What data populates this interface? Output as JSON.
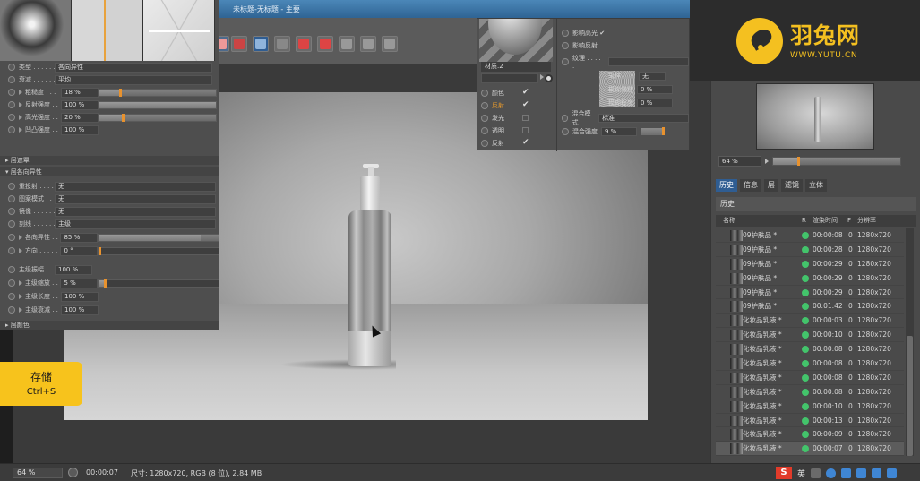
{
  "app": {
    "window_title": "未标题-无标题 - 主要"
  },
  "left_panel": {
    "rows_top": [
      {
        "label": "类型 . . . . . .",
        "value": "各向异性"
      },
      {
        "label": "衰减 . . . . . .",
        "value": "平均"
      },
      {
        "label": "粗糙度 . . .",
        "value": "18 %",
        "fill": 0.18
      },
      {
        "label": "反射强度 . .",
        "value": "100 %",
        "fill": 1.0
      },
      {
        "label": "高光强度 . .",
        "value": "20 %",
        "fill": 0.2
      },
      {
        "label": "凹凸强度 . .",
        "value": "100 %",
        "fill": 1.0
      }
    ],
    "section_layer_mask": "▸ 层遮罩",
    "section_anisotropy": "▾ 层各向异性",
    "rows_aniso": [
      {
        "label": "重投射 . . . .",
        "value": "无"
      },
      {
        "label": "图案模式 . .",
        "value": "无"
      },
      {
        "label": "镜像 . . . . . .",
        "value": "无"
      },
      {
        "label": "刻线 . . . . . .",
        "value": "主级"
      },
      {
        "label": "各向异性 . .",
        "value": "85 %"
      },
      {
        "label": "方向 . . . . . .",
        "value": "0 °"
      }
    ],
    "rows_primary": [
      {
        "label": "主级振幅 . .",
        "value": "100 %"
      },
      {
        "label": "主级缩放 . .",
        "value": "5 %",
        "fill": 0.05
      },
      {
        "label": "主级长度 . .",
        "value": "100 %"
      },
      {
        "label": "主级衰减 . .",
        "value": "100 %"
      }
    ],
    "section_layer_color": "▸ 层颜色"
  },
  "material_editor": {
    "material_name": "材质.2",
    "channels": [
      {
        "label": "颜色",
        "checked": "✔",
        "highlight": false
      },
      {
        "label": "反射",
        "checked": "✔",
        "highlight": true
      },
      {
        "label": "发光",
        "checked": "",
        "highlight": false
      },
      {
        "label": "透明",
        "checked": "",
        "highlight": false
      },
      {
        "label": "反射",
        "checked": "✔",
        "highlight": false
      }
    ],
    "opt_highlight": "影响高光 ✔",
    "opt_reflect": "影响反射",
    "texture_label": "纹理 . . . . .",
    "sampling_label": "采样",
    "sampling_value": "无",
    "blur_offset_label": "模糊偏移",
    "blur_offset_value": "0 %",
    "blur_scale_label": "模糊程度",
    "blur_scale_value": "0 %",
    "blend_mode_label": "混合模式",
    "blend_mode_value": "标准",
    "blend_strength_label": "混合强度",
    "blend_strength_value": "9 %"
  },
  "logo": {
    "name": "羽兔网",
    "url": "WWW.YUTU.CN"
  },
  "right_panel": {
    "zoom": "64 %",
    "zoom_fill": 0.2,
    "tabs": [
      "历史",
      "信息",
      "层",
      "滤镜",
      "立体"
    ],
    "history_title": "历史",
    "columns": {
      "name": "名称",
      "r": "R",
      "time": "渲染时间",
      "f": "F",
      "res": "分辨率"
    },
    "rows": [
      {
        "name": "09护肤品 *",
        "time": "00:00:08",
        "f": "0",
        "res": "1280x720"
      },
      {
        "name": "09护肤品 *",
        "time": "00:00:28",
        "f": "0",
        "res": "1280x720"
      },
      {
        "name": "09护肤品 *",
        "time": "00:00:29",
        "f": "0",
        "res": "1280x720"
      },
      {
        "name": "09护肤品 *",
        "time": "00:00:29",
        "f": "0",
        "res": "1280x720"
      },
      {
        "name": "09护肤品 *",
        "time": "00:00:29",
        "f": "0",
        "res": "1280x720"
      },
      {
        "name": "09护肤品 *",
        "time": "00:01:42",
        "f": "0",
        "res": "1280x720"
      },
      {
        "name": "化妆品乳液 *",
        "time": "00:00:03",
        "f": "0",
        "res": "1280x720"
      },
      {
        "name": "化妆品乳液 *",
        "time": "00:00:10",
        "f": "0",
        "res": "1280x720"
      },
      {
        "name": "化妆品乳液 *",
        "time": "00:00:08",
        "f": "0",
        "res": "1280x720"
      },
      {
        "name": "化妆品乳液 *",
        "time": "00:00:08",
        "f": "0",
        "res": "1280x720"
      },
      {
        "name": "化妆品乳液 *",
        "time": "00:00:08",
        "f": "0",
        "res": "1280x720"
      },
      {
        "name": "化妆品乳液 *",
        "time": "00:00:08",
        "f": "0",
        "res": "1280x720"
      },
      {
        "name": "化妆品乳液 *",
        "time": "00:00:10",
        "f": "0",
        "res": "1280x720"
      },
      {
        "name": "化妆品乳液 *",
        "time": "00:00:13",
        "f": "0",
        "res": "1280x720"
      },
      {
        "name": "化妆品乳液 *",
        "time": "00:00:09",
        "f": "0",
        "res": "1280x720"
      },
      {
        "name": "化妆品乳液 *",
        "time": "00:00:07",
        "f": "0",
        "res": "1280x720"
      }
    ]
  },
  "save_hint": {
    "title": "存储",
    "shortcut": "Ctrl+S"
  },
  "status_bar": {
    "zoom": "64 %",
    "time": "00:00:07",
    "info": "尺寸: 1280x720, RGB (8 位), 2.84 MB"
  },
  "tray": {
    "ime": "S",
    "lang": "英"
  },
  "colors": {
    "accent": "#e8922e",
    "logo": "#f4c020",
    "status_ok": "#43c46b",
    "tab_active": "#2f5d92"
  }
}
